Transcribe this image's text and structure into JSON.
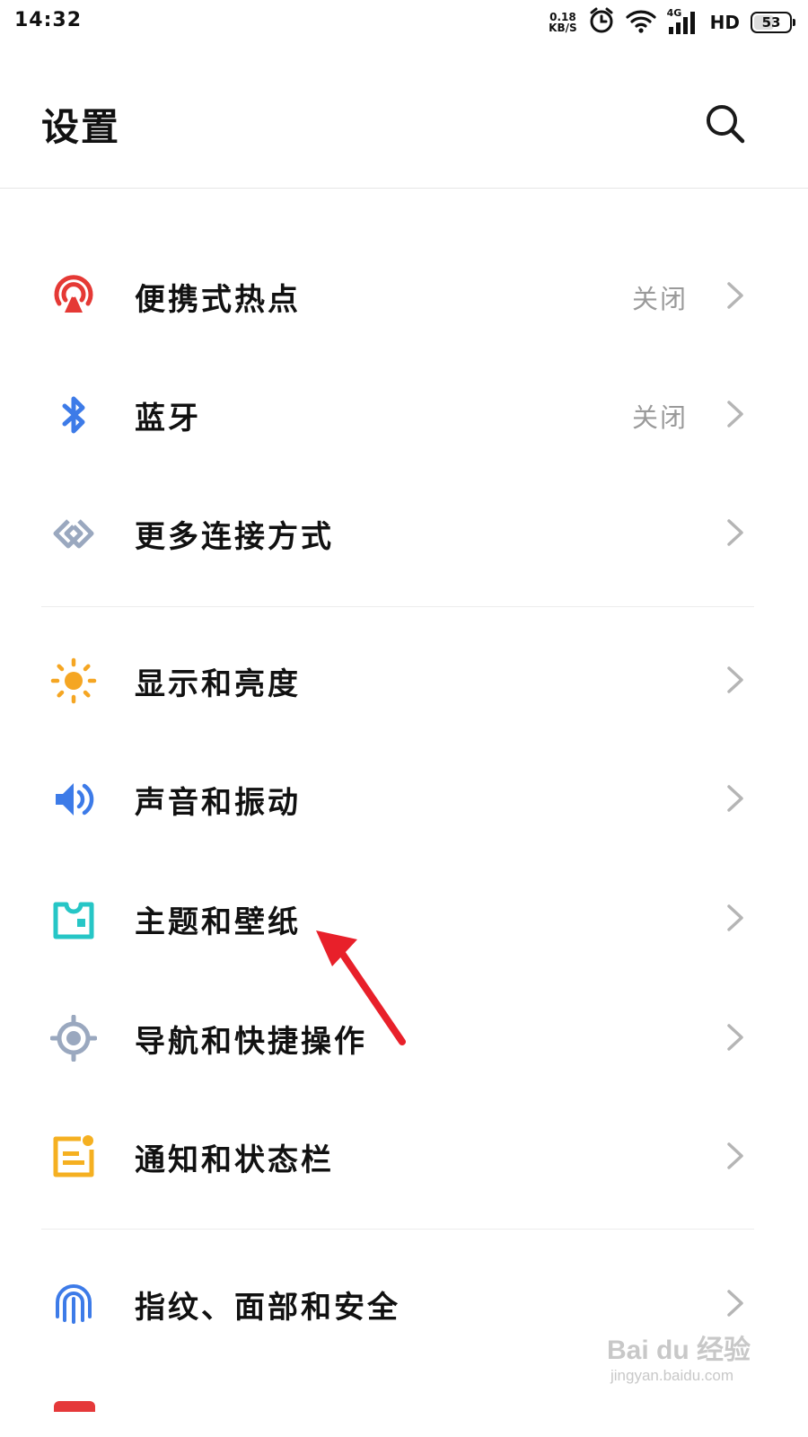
{
  "status_bar": {
    "time": "14:32",
    "net_speed_value": "0.18",
    "net_speed_unit": "KB/S",
    "network_type": "4G",
    "hd_label": "HD",
    "battery_percent": "53"
  },
  "header": {
    "title": "设置",
    "search_icon": "search-icon"
  },
  "settings": [
    {
      "id": "hotspot",
      "label": "便携式热点",
      "value": "关闭",
      "icon": "hotspot-icon",
      "icon_color": "#e53935"
    },
    {
      "id": "bluetooth",
      "label": "蓝牙",
      "value": "关闭",
      "icon": "bluetooth-icon",
      "icon_color": "#3d7be8"
    },
    {
      "id": "more-connections",
      "label": "更多连接方式",
      "value": "",
      "icon": "link-icon",
      "icon_color": "#9aa8bf"
    },
    {
      "id": "display",
      "label": "显示和亮度",
      "value": "",
      "icon": "sun-icon",
      "icon_color": "#f5a623"
    },
    {
      "id": "sound",
      "label": "声音和振动",
      "value": "",
      "icon": "speaker-icon",
      "icon_color": "#3d7be8"
    },
    {
      "id": "theme",
      "label": "主题和壁纸",
      "value": "",
      "icon": "theme-icon",
      "icon_color": "#26c6c6"
    },
    {
      "id": "navigation",
      "label": "导航和快捷操作",
      "value": "",
      "icon": "navigation-icon",
      "icon_color": "#9aa8bf"
    },
    {
      "id": "notifications",
      "label": "通知和状态栏",
      "value": "",
      "icon": "notification-icon",
      "icon_color": "#f5b021"
    },
    {
      "id": "security",
      "label": "指纹、面部和安全",
      "value": "",
      "icon": "fingerprint-icon",
      "icon_color": "#3d7be8"
    }
  ],
  "watermark": {
    "brand": "Bai du 经验",
    "sub": "jingyan.baidu.com"
  },
  "annotation_color": "#e8202a"
}
